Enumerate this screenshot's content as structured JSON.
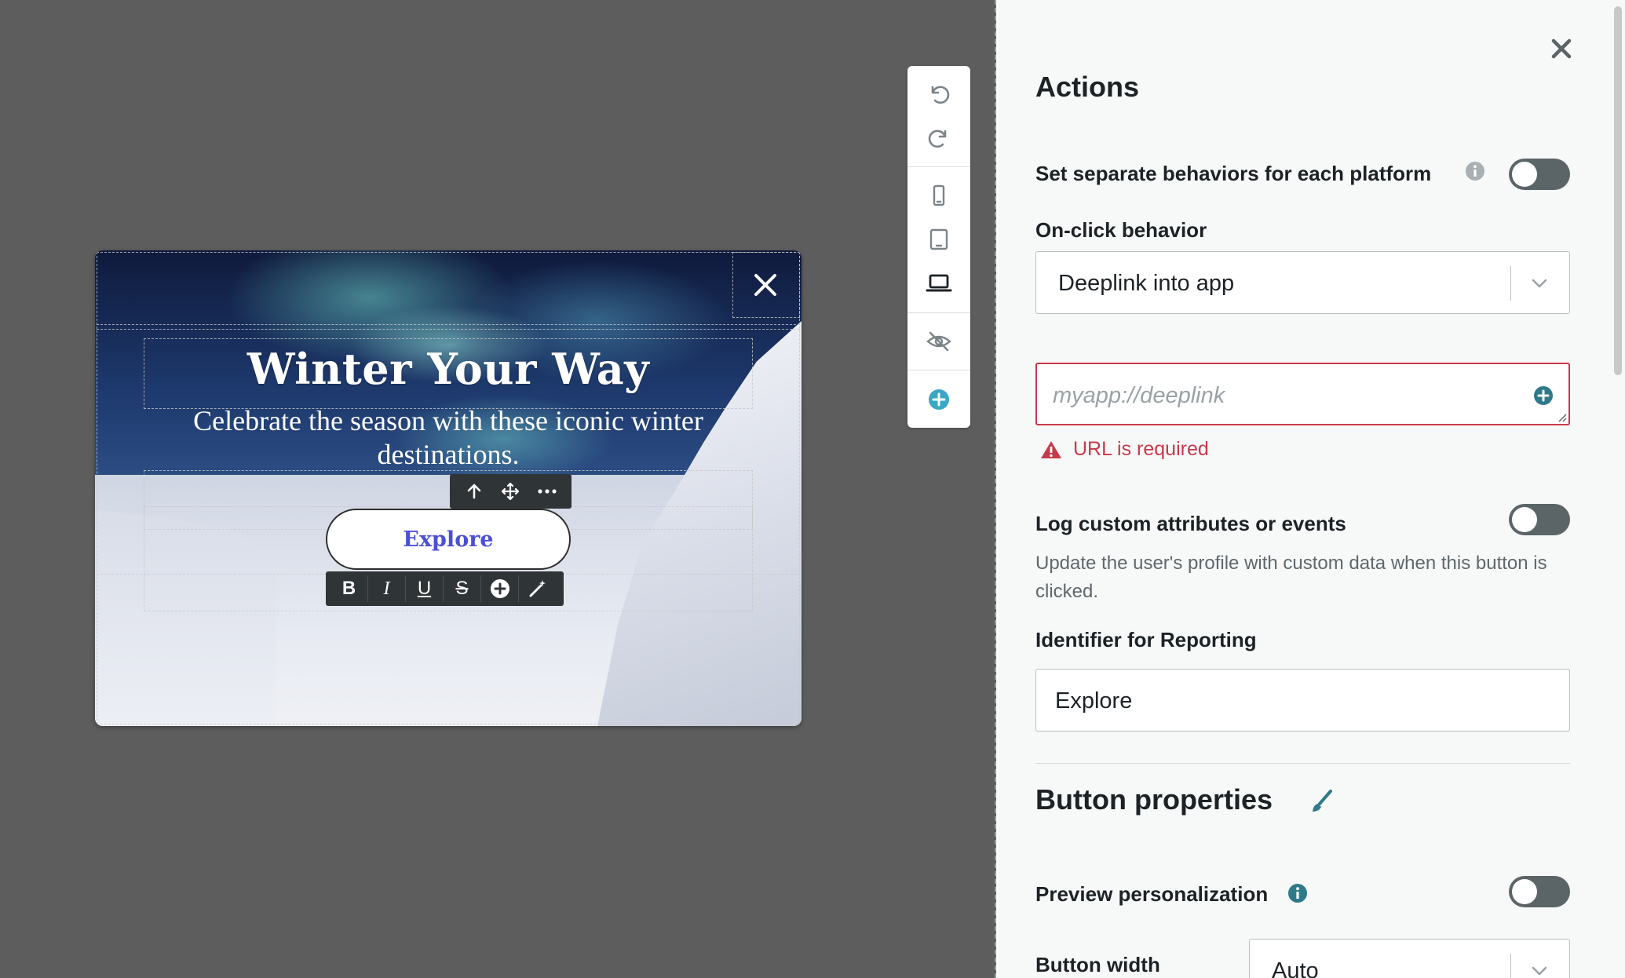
{
  "preview": {
    "headline": "Winter Your Way",
    "subline": "Celebrate the season with these iconic winter destinations.",
    "button_label": "Explore",
    "format_toolbar": [
      "B",
      "I",
      "U",
      "S"
    ]
  },
  "panel": {
    "title": "Actions",
    "platform_label": "Set separate behaviors for each platform",
    "onclick_label": "On-click behavior",
    "onclick_value": "Deeplink into app",
    "url_placeholder": "myapp://deeplink",
    "url_error": "URL is required",
    "log_label": "Log custom attributes or events",
    "log_helper": "Update the user's profile with custom data when this button is clicked.",
    "identifier_label": "Identifier for Reporting",
    "identifier_value": "Explore",
    "section_title": "Button properties",
    "preview_personalization_label": "Preview personalization",
    "button_width_label": "Button width",
    "button_width_value": "Auto"
  },
  "colors": {
    "accent_teal": "#2f7a8a",
    "error_red": "#c73a4a",
    "button_text": "#4b4fd6",
    "toggle_off": "#5b6467"
  },
  "icons": [
    "undo-icon",
    "redo-icon",
    "phone-icon",
    "tablet-icon",
    "laptop-icon",
    "hide-icon",
    "add-icon",
    "close-icon",
    "move-up-icon",
    "drag-icon",
    "more-icon",
    "bold-icon",
    "italic-icon",
    "underline-icon",
    "strikethrough-icon",
    "insert-icon",
    "magic-wand-icon",
    "info-icon",
    "chevron-down-icon",
    "warning-icon",
    "brush-icon"
  ]
}
